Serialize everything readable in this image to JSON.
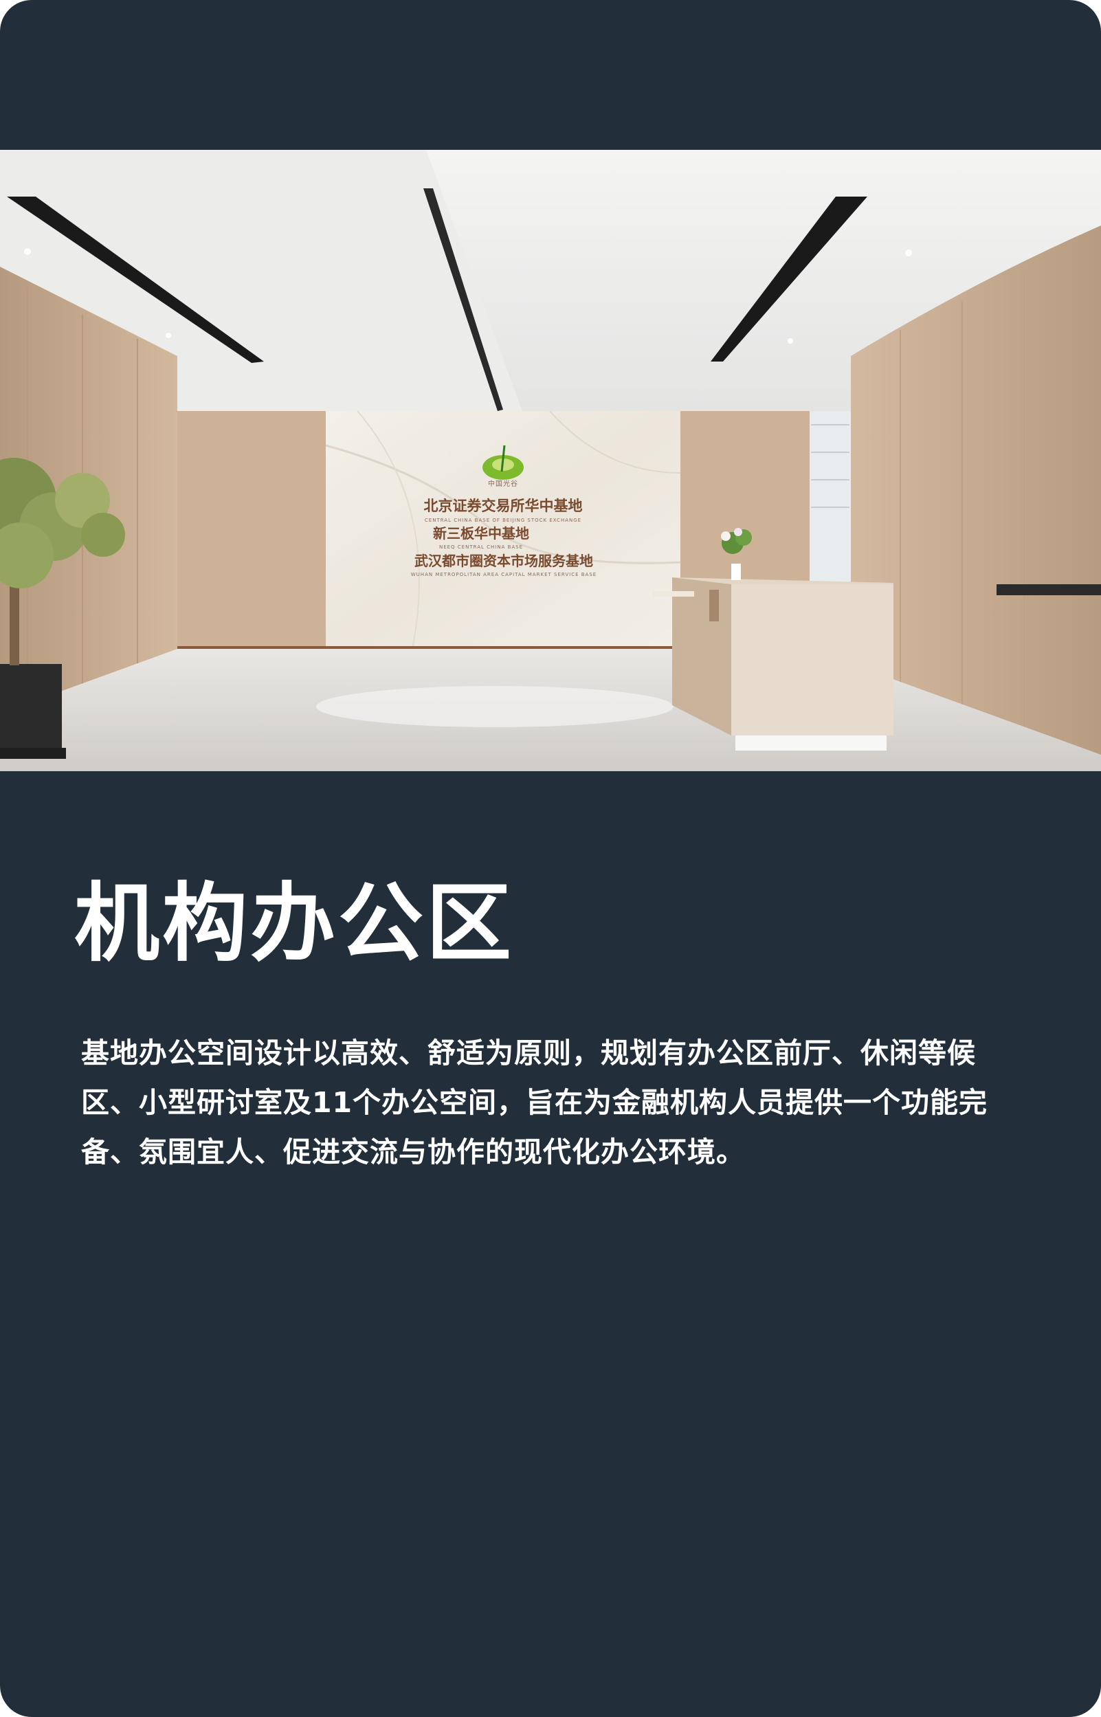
{
  "card": {
    "title": "机构办公区",
    "description": "基地办公空间设计以高效、舒适为原则，规划有办公区前厅、休闲等候区、小型研讨室及11个办公空间，旨在为金融机构人员提供一个功能完备、氛围宜人、促进交流与协作的现代化办公环境。"
  },
  "photo": {
    "logo_text": "中国光谷",
    "sign_lines": [
      "北京证券交易所华中基地",
      "CENTRAL CHINA BASE OF BEIJING STOCK EXCHANGE",
      "新三板华中基地",
      "NEEQ CENTRAL CHINA BASE",
      "武汉都市圈资本市场服务基地",
      "WUHAN METROPOLITAN AREA CAPITAL MARKET SERVICE BASE"
    ]
  },
  "colors": {
    "card_background": "#222f3a",
    "text": "#ffffff",
    "wood": "#c9ad91",
    "sign_brown": "#7a4a2e"
  }
}
